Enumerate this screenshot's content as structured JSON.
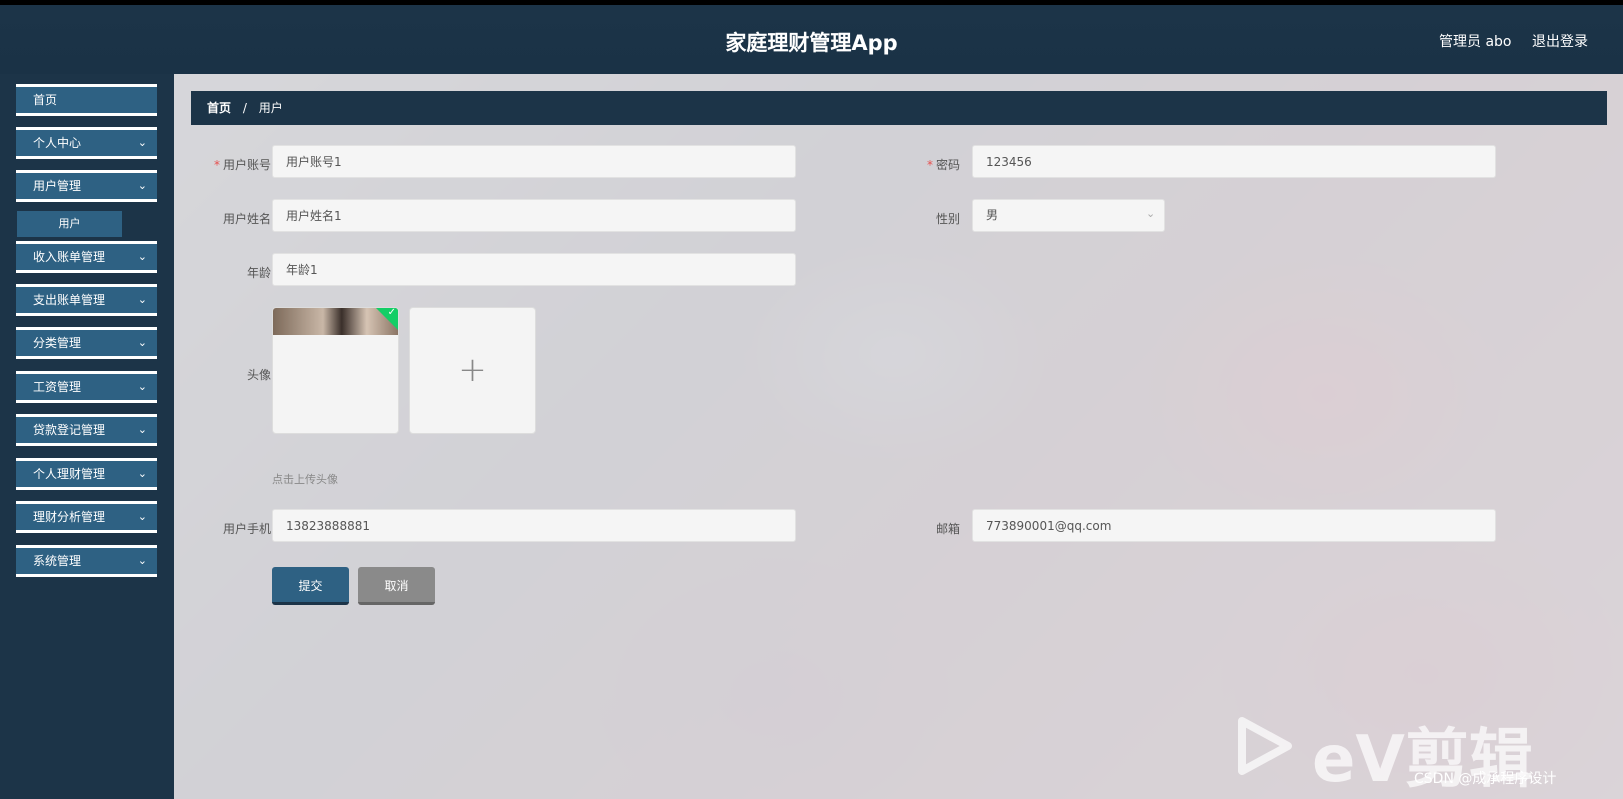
{
  "header": {
    "title": "家庭理财管理App",
    "user": "管理员 abo",
    "logout": "退出登录"
  },
  "sidebar": {
    "items": [
      {
        "label": "首页",
        "chevron": false
      },
      {
        "label": "个人中心",
        "chevron": true
      },
      {
        "label": "用户管理",
        "chevron": true
      },
      {
        "label": "收入账单管理",
        "chevron": true
      },
      {
        "label": "支出账单管理",
        "chevron": true
      },
      {
        "label": "分类管理",
        "chevron": true
      },
      {
        "label": "工资管理",
        "chevron": true
      },
      {
        "label": "贷款登记管理",
        "chevron": true
      },
      {
        "label": "个人理财管理",
        "chevron": true
      },
      {
        "label": "理财分析管理",
        "chevron": true
      },
      {
        "label": "系统管理",
        "chevron": true
      }
    ],
    "subitem": "用户"
  },
  "breadcrumb": {
    "home": "首页",
    "separator": "/",
    "current": "用户"
  },
  "form": {
    "account_label": "用户账号",
    "account_value": "用户账号1",
    "password_label": "密码",
    "password_value": "123456",
    "name_label": "用户姓名",
    "name_value": "用户姓名1",
    "gender_label": "性别",
    "gender_value": "男",
    "age_label": "年龄",
    "age_value": "年龄1",
    "avatar_label": "头像",
    "avatar_hint": "点击上传头像",
    "phone_label": "用户手机",
    "phone_value": "13823888881",
    "email_label": "邮箱",
    "email_value": "773890001@qq.com",
    "submit": "提交",
    "cancel": "取消"
  },
  "watermark": {
    "ev": "eV剪辑",
    "csdn": "CSDN @成承程序设计"
  }
}
